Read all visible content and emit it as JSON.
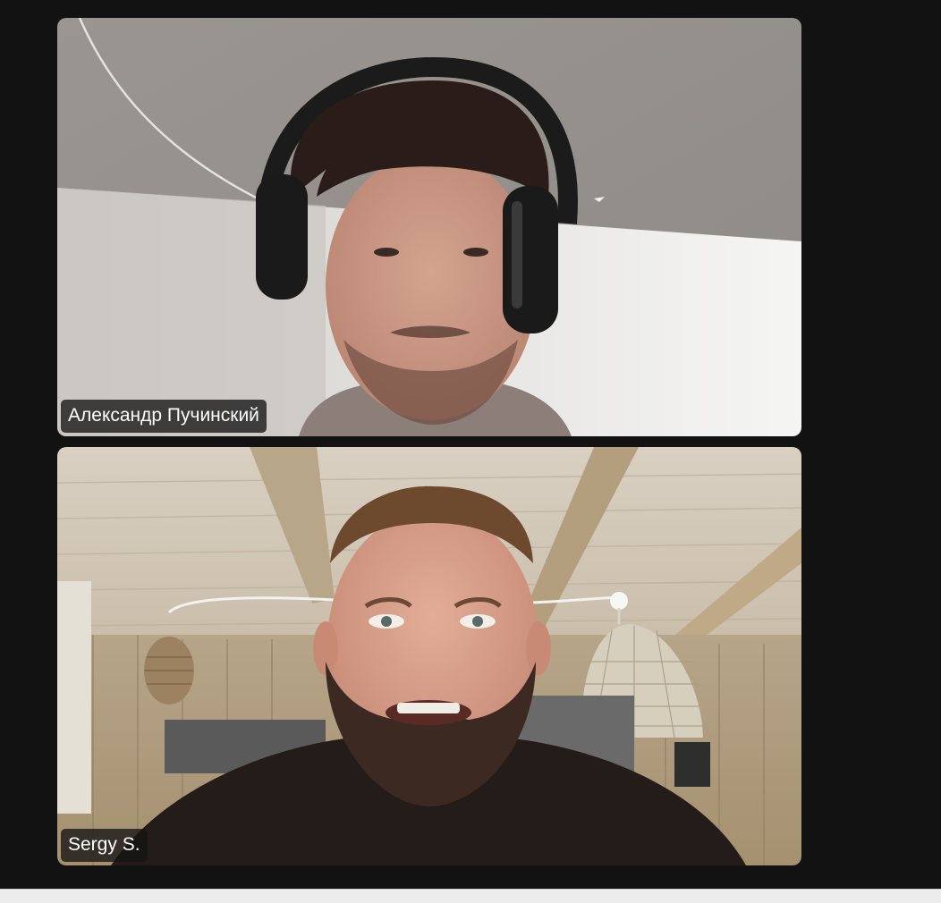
{
  "participants": [
    {
      "name": "Александр Пучинский",
      "video": "video-feed"
    },
    {
      "name": "Sergy S.",
      "video": "video-feed"
    }
  ]
}
